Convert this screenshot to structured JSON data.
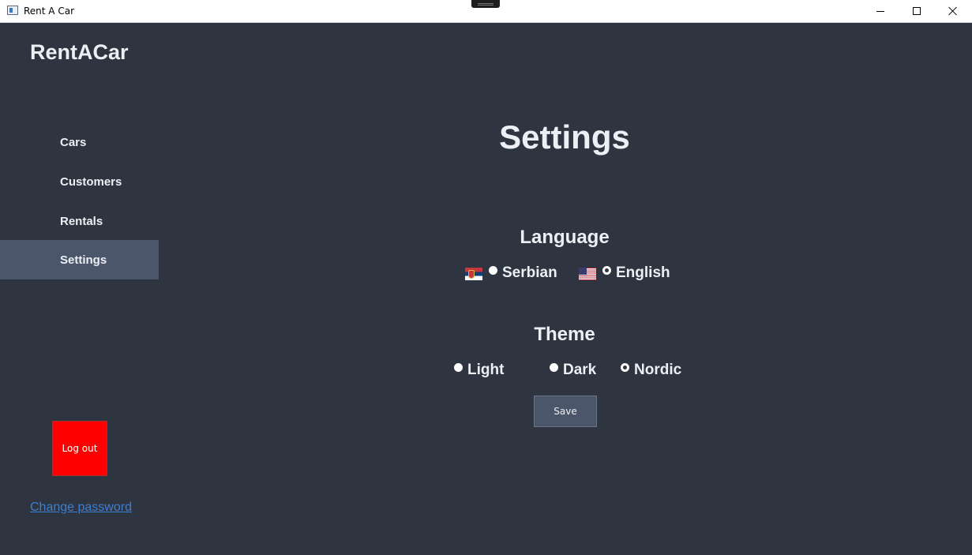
{
  "window": {
    "title": "Rent A Car"
  },
  "sidebar": {
    "brand": "RentACar",
    "items": [
      {
        "label": "Cars",
        "active": false
      },
      {
        "label": "Customers",
        "active": false
      },
      {
        "label": "Rentals",
        "active": false
      },
      {
        "label": "Settings",
        "active": true
      }
    ],
    "logout_label": "Log out",
    "change_password_label": "Change password"
  },
  "settings": {
    "title": "Settings",
    "language": {
      "title": "Language",
      "options": [
        {
          "label": "Serbian",
          "icon": "serbia-flag-icon",
          "selected": false
        },
        {
          "label": "English",
          "icon": "usa-flag-icon",
          "selected": true
        }
      ]
    },
    "theme": {
      "title": "Theme",
      "options": [
        {
          "label": "Light",
          "selected": false
        },
        {
          "label": "Dark",
          "selected": false
        },
        {
          "label": "Nordic",
          "selected": true
        }
      ]
    },
    "save_label": "Save"
  },
  "colors": {
    "background": "#2e3440",
    "sidebar_active": "#4c566a",
    "text": "#eceff4",
    "logout": "#ff0000",
    "link": "#3d7fd1"
  }
}
